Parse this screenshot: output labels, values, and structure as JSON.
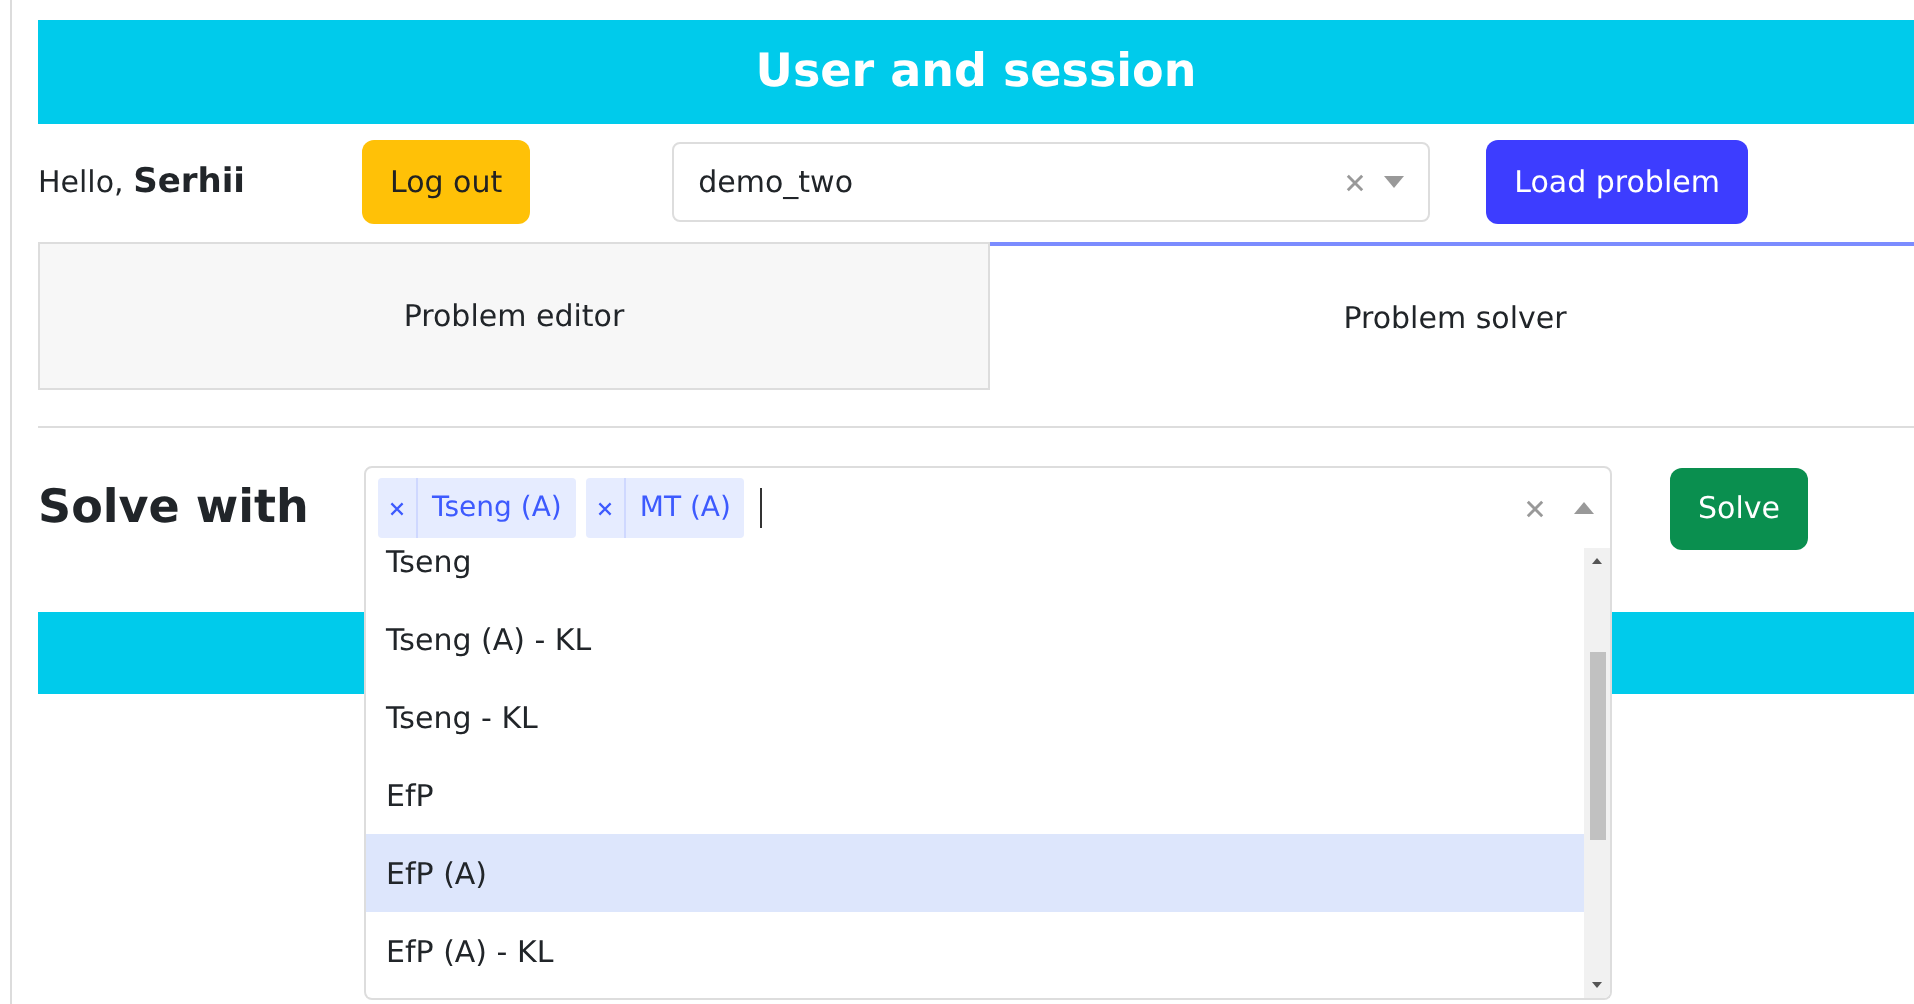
{
  "header": {
    "title": "User and session"
  },
  "user_bar": {
    "greeting": "Hello,",
    "user_name": "Serhii",
    "logout_button": "Log out",
    "problem_select": {
      "value": "demo_two"
    },
    "load_button": "Load problem"
  },
  "tabs": [
    {
      "label": "Problem editor",
      "selected": false
    },
    {
      "label": "Problem solver",
      "selected": true
    }
  ],
  "solver": {
    "title": "Solve with",
    "expanded": true,
    "selected_methods": [
      {
        "label": "Tseng (A)"
      },
      {
        "label": "MT (A)"
      }
    ],
    "options": [
      {
        "label": "Tseng",
        "selected": false
      },
      {
        "label": "Tseng (A) - KL",
        "selected": false
      },
      {
        "label": "Tseng - KL",
        "selected": false
      },
      {
        "label": "EfP",
        "selected": false
      },
      {
        "label": "EfP (A)",
        "selected": true
      },
      {
        "label": "EfP (A) - KL",
        "selected": false
      }
    ],
    "solve_button": "Solve"
  }
}
